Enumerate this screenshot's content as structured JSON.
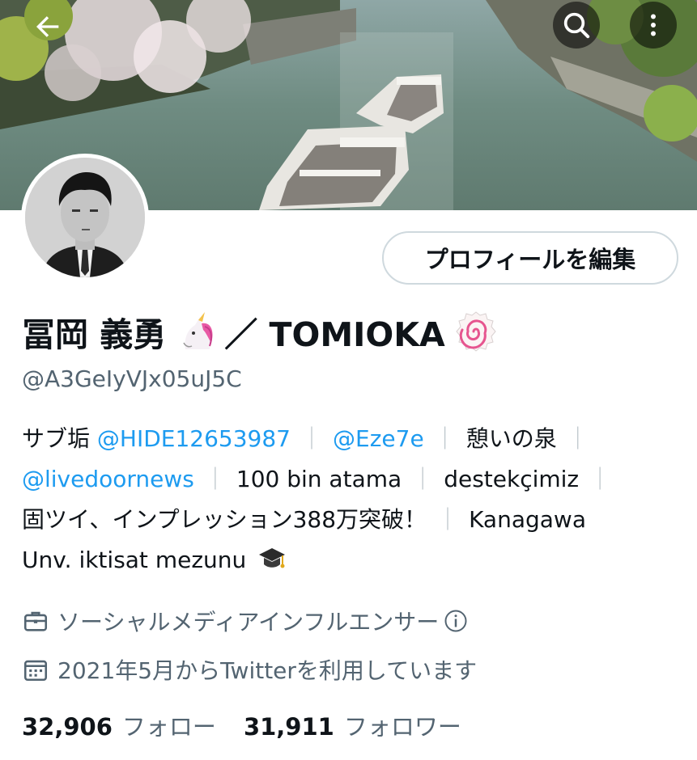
{
  "header": {
    "back_icon": "arrow-left-icon",
    "search_icon": "search-icon",
    "more_icon": "more-vertical-icon"
  },
  "profile": {
    "edit_button_label": "プロフィールを編集",
    "name_part1": "冨岡 義勇",
    "name_emoji1": "unicorn-emoji",
    "name_part2": "／ TOMIOKA",
    "name_emoji2": "fish-cake-emoji",
    "handle": "@A3GeIyVJx05uJ5C"
  },
  "bio": {
    "line1": [
      {
        "text": "サブ垢 ",
        "type": "text"
      },
      {
        "text": "@HIDE12653987",
        "type": "link"
      },
      {
        "text": "｜",
        "type": "sep"
      },
      {
        "text": "@Eze7e",
        "type": "link"
      },
      {
        "text": "｜",
        "type": "sep"
      },
      {
        "text": "憩いの泉",
        "type": "text"
      },
      {
        "text": "｜",
        "type": "sep"
      }
    ],
    "line2": [
      {
        "text": "@livedoornews",
        "type": "link"
      },
      {
        "text": "｜",
        "type": "sep"
      },
      {
        "text": "100 bin atama",
        "type": "text"
      },
      {
        "text": "｜",
        "type": "sep"
      },
      {
        "text": "destekçimiz",
        "type": "text"
      },
      {
        "text": "｜",
        "type": "sep"
      }
    ],
    "line3": [
      {
        "text": "固ツイ、インプレッション388万突破！",
        "type": "text"
      },
      {
        "text": "｜",
        "type": "sep"
      },
      {
        "text": "Kanagawa",
        "type": "text"
      }
    ],
    "line4_text": "Unv. iktisat mezunu",
    "line4_emoji": "graduation-cap-emoji"
  },
  "meta": {
    "category": "ソーシャルメディアインフルエンサー",
    "category_icon": "briefcase-icon",
    "info_icon": "info-icon",
    "joined": "2021年5月からTwitterを利用しています",
    "joined_icon": "calendar-icon"
  },
  "stats": {
    "following_count": "32,906",
    "following_label": "フォロー",
    "followers_count": "31,911",
    "followers_label": "フォロワー"
  },
  "colors": {
    "link": "#1d9bf0",
    "secondary_text": "#536471",
    "border": "#cfd9de"
  }
}
